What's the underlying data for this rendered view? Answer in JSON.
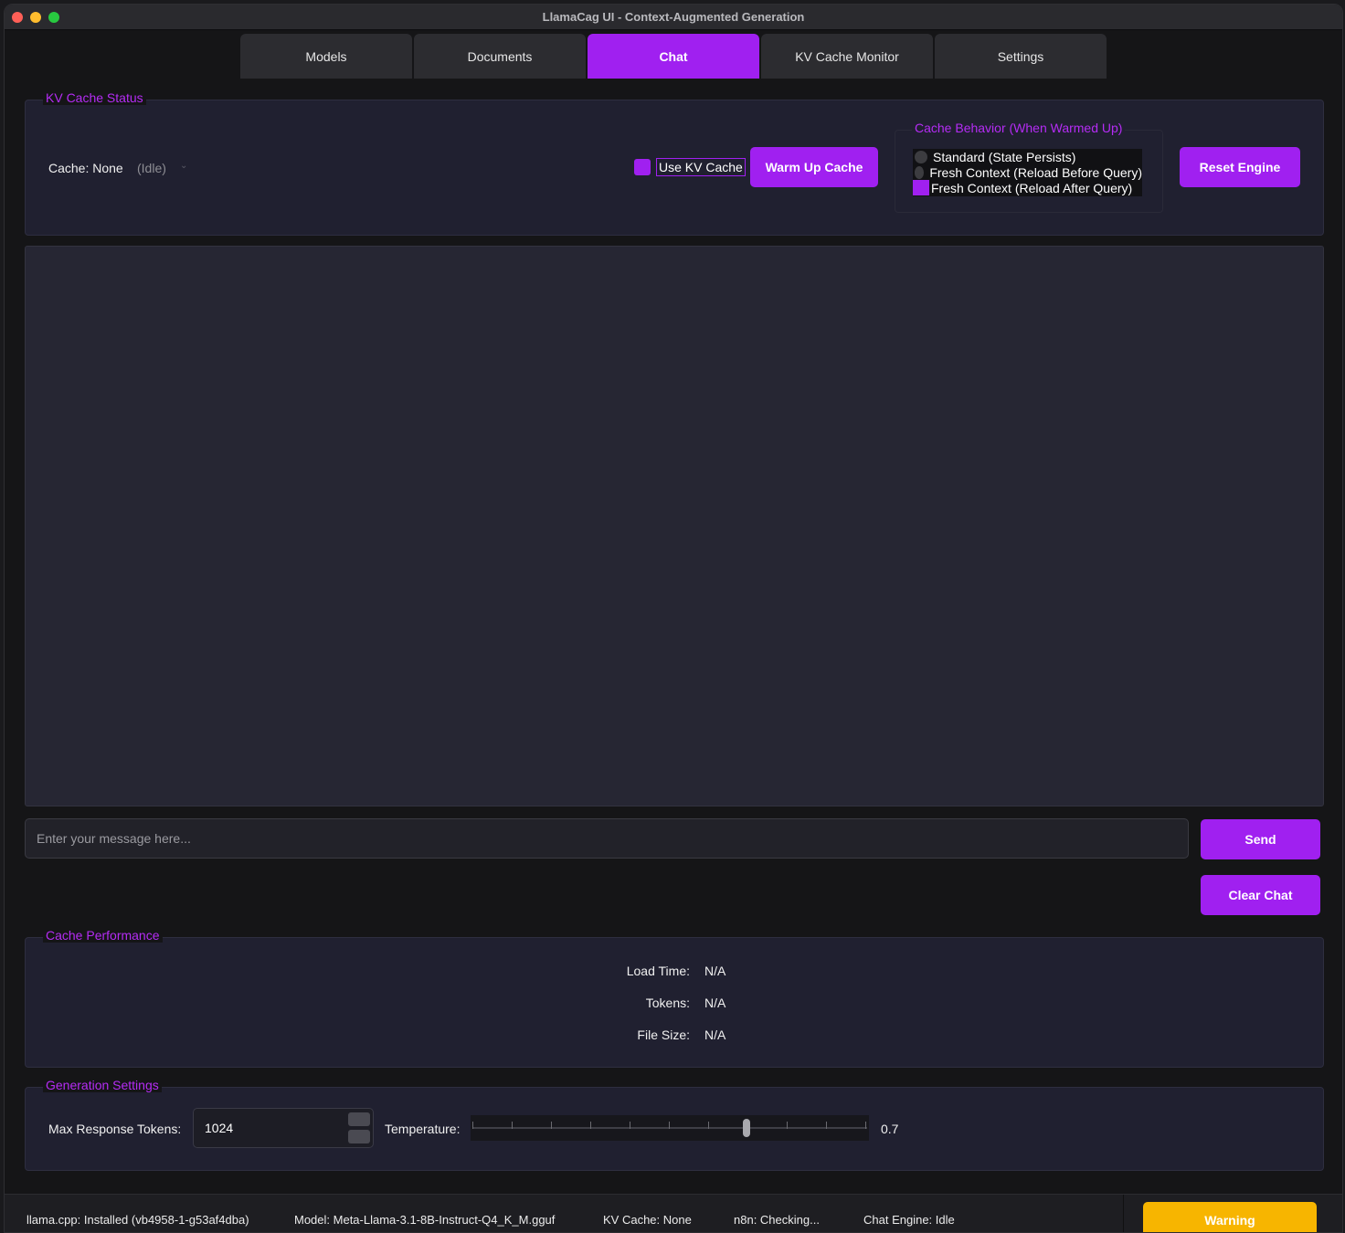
{
  "window": {
    "title": "LlamaCag UI - Context-Augmented Generation"
  },
  "tabs": [
    {
      "label": "Models",
      "active": false
    },
    {
      "label": "Documents",
      "active": false
    },
    {
      "label": "Chat",
      "active": true
    },
    {
      "label": "KV Cache Monitor",
      "active": false
    },
    {
      "label": "Settings",
      "active": false
    }
  ],
  "kv_status": {
    "group_title": "KV Cache Status",
    "cache_label": "Cache: None",
    "state_label": "(Idle)",
    "use_kv_cache_label": "Use KV Cache",
    "use_kv_cache_checked": true,
    "warm_up_label": "Warm Up Cache",
    "reset_label": "Reset Engine",
    "behavior": {
      "title": "Cache Behavior (When Warmed Up)",
      "options": [
        "Standard (State Persists)",
        "Fresh Context (Reload Before Query)",
        "Fresh Context (Reload After Query)"
      ],
      "selected_index": 2
    }
  },
  "chat": {
    "input_placeholder": "Enter your message here...",
    "input_value": "",
    "send_label": "Send",
    "clear_label": "Clear Chat"
  },
  "performance": {
    "group_title": "Cache Performance",
    "rows": [
      {
        "label": "Load Time:",
        "value": "N/A"
      },
      {
        "label": "Tokens:",
        "value": "N/A"
      },
      {
        "label": "File Size:",
        "value": "N/A"
      }
    ]
  },
  "generation": {
    "group_title": "Generation Settings",
    "max_tokens_label": "Max Response Tokens:",
    "max_tokens_value": "1024",
    "temperature_label": "Temperature:",
    "temperature_value": "0.7",
    "temperature_fraction": 0.7
  },
  "statusbar": {
    "llama": "llama.cpp: Installed (vb4958-1-g53af4dba)",
    "model": "Model: Meta-Llama-3.1-8B-Instruct-Q4_K_M.gguf",
    "kv_cache": "KV Cache: None",
    "n8n": "n8n: Checking...",
    "chat_engine": "Chat Engine: Idle",
    "warning": "Warning"
  },
  "colors": {
    "accent": "#a020f0",
    "warning": "#f7b500"
  }
}
